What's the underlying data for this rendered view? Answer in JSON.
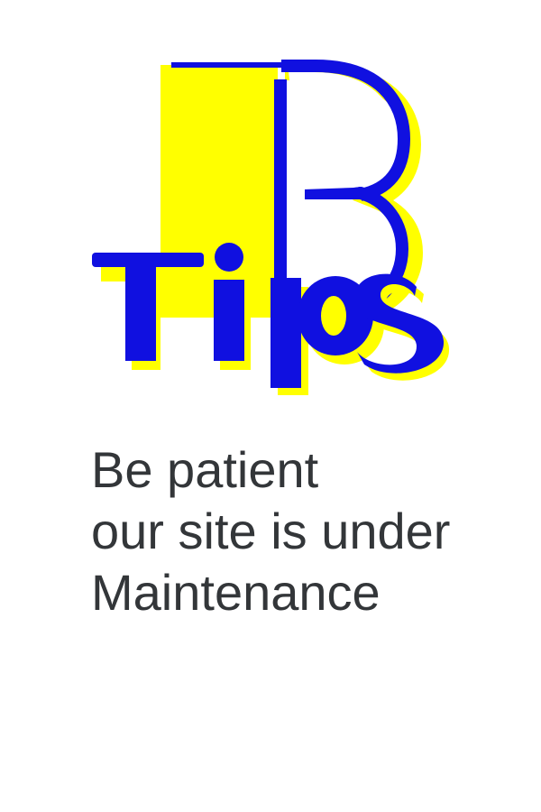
{
  "logo": {
    "name": "BTips logo",
    "text": "Tips",
    "letter": "B",
    "colors": {
      "primary": "#1010e0",
      "accent": "#ffff00"
    }
  },
  "message": {
    "line1": "Be patient",
    "line2": "our site is under",
    "line3": "Maintenance"
  }
}
